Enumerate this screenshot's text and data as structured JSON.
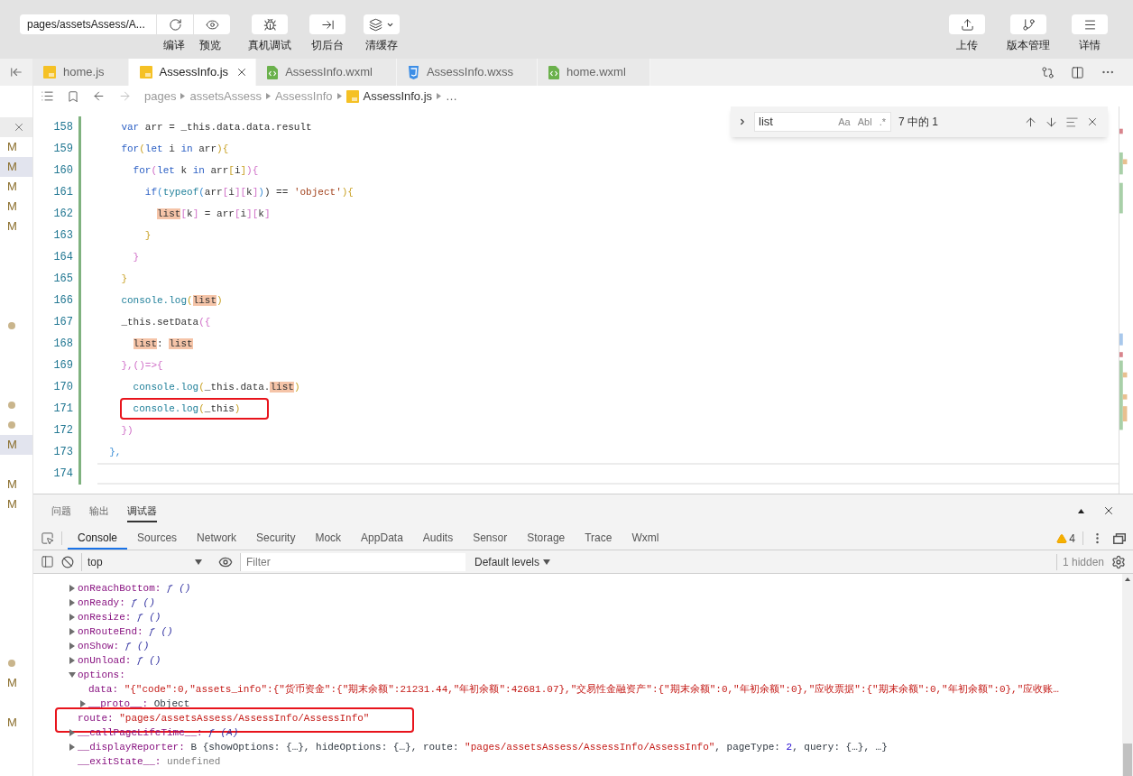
{
  "toolbar": {
    "page_select": "pages/assetsAssess/A...",
    "left_buttons": [
      {
        "kind": "compile",
        "label": "编译"
      },
      {
        "kind": "preview",
        "label": "预览"
      },
      {
        "kind": "debug",
        "label": "真机调试"
      },
      {
        "kind": "background",
        "label": "切后台"
      },
      {
        "kind": "cache",
        "label": "清缓存"
      }
    ],
    "right_buttons": [
      {
        "kind": "upload",
        "label": "上传"
      },
      {
        "kind": "version",
        "label": "版本管理"
      },
      {
        "kind": "details",
        "label": "详情"
      }
    ]
  },
  "tabs": [
    {
      "label": "home.js",
      "kind": "js",
      "selected": false
    },
    {
      "label": "AssessInfo.js",
      "kind": "js",
      "selected": true
    },
    {
      "label": "AssessInfo.wxml",
      "kind": "wxml",
      "selected": false
    },
    {
      "label": "AssessInfo.wxss",
      "kind": "wxss",
      "selected": false
    },
    {
      "label": "home.wxml",
      "kind": "wxml",
      "selected": false
    }
  ],
  "breadcrumb": [
    "pages",
    "assetsAssess",
    "AssessInfo",
    "AssessInfo.js",
    "…"
  ],
  "side_markers": [
    {
      "kind": "close"
    },
    {
      "kind": "modified",
      "label": "M",
      "selected": false
    },
    {
      "kind": "modified",
      "label": "M",
      "selected": true
    },
    {
      "kind": "modified",
      "label": "M",
      "selected": false
    },
    {
      "kind": "modified",
      "label": "M",
      "selected": false
    },
    {
      "kind": "modified",
      "label": "M",
      "selected": false
    },
    {
      "kind": "blank"
    },
    {
      "kind": "blank"
    },
    {
      "kind": "blank"
    },
    {
      "kind": "blank"
    },
    {
      "kind": "dot"
    },
    {
      "kind": "blank"
    },
    {
      "kind": "blank"
    },
    {
      "kind": "blank"
    },
    {
      "kind": "dot"
    },
    {
      "kind": "dot"
    },
    {
      "kind": "modified",
      "label": "M",
      "selected": true
    },
    {
      "kind": "blank"
    },
    {
      "kind": "modified",
      "label": "M",
      "selected": false
    },
    {
      "kind": "modified",
      "label": "M",
      "selected": false
    },
    {
      "kind": "blank"
    },
    {
      "kind": "blank"
    },
    {
      "kind": "blank"
    },
    {
      "kind": "blank"
    },
    {
      "kind": "blank"
    },
    {
      "kind": "blank"
    },
    {
      "kind": "blank"
    },
    {
      "kind": "dot"
    },
    {
      "kind": "modified",
      "label": "M",
      "selected": false
    },
    {
      "kind": "blank"
    },
    {
      "kind": "modified",
      "label": "M",
      "selected": false
    }
  ],
  "code_lines": [
    {
      "number": "158",
      "current": false,
      "boxed": false,
      "tokens": [
        {
          "text": "    var",
          "kind": "kw"
        },
        {
          "text": " arr = _this.data.data.result",
          "kind": "id"
        }
      ]
    },
    {
      "number": "159",
      "current": false,
      "boxed": false,
      "tokens": [
        {
          "text": "    for",
          "kind": "kw"
        },
        {
          "text": "(",
          "kind": "b1"
        },
        {
          "text": "let",
          "kind": "kw"
        },
        {
          "text": " i ",
          "kind": "id"
        },
        {
          "text": "in",
          "kind": "kw"
        },
        {
          "text": " arr",
          "kind": "id"
        },
        {
          "text": "){",
          "kind": "b1"
        }
      ]
    },
    {
      "number": "160",
      "current": false,
      "boxed": false,
      "tokens": [
        {
          "text": "      for",
          "kind": "kw"
        },
        {
          "text": "(",
          "kind": "b2"
        },
        {
          "text": "let",
          "kind": "kw"
        },
        {
          "text": " k ",
          "kind": "id"
        },
        {
          "text": "in",
          "kind": "kw"
        },
        {
          "text": " arr",
          "kind": "id"
        },
        {
          "text": "[",
          "kind": "b1"
        },
        {
          "text": "i",
          "kind": "id"
        },
        {
          "text": "]",
          "kind": "b1"
        },
        {
          "text": "){",
          "kind": "b2"
        }
      ]
    },
    {
      "number": "161",
      "current": false,
      "boxed": false,
      "tokens": [
        {
          "text": "        if",
          "kind": "kw"
        },
        {
          "text": "(",
          "kind": "b3"
        },
        {
          "text": "typeof",
          "kind": "fn"
        },
        {
          "text": "(",
          "kind": "b3"
        },
        {
          "text": "arr",
          "kind": "id"
        },
        {
          "text": "[",
          "kind": "b2"
        },
        {
          "text": "i",
          "kind": "id"
        },
        {
          "text": "][",
          "kind": "b2"
        },
        {
          "text": "k",
          "kind": "id"
        },
        {
          "text": "]",
          "kind": "b2"
        },
        {
          "text": ")",
          "kind": "b3"
        },
        {
          "text": ") == ",
          "kind": "id"
        },
        {
          "text": "'object'",
          "kind": "str"
        },
        {
          "text": "){",
          "kind": "b1"
        }
      ]
    },
    {
      "number": "162",
      "current": false,
      "boxed": false,
      "tokens": [
        {
          "text": "          list",
          "kind": "hl"
        },
        {
          "text": "[",
          "kind": "b2"
        },
        {
          "text": "k",
          "kind": "id"
        },
        {
          "text": "]",
          "kind": "b2"
        },
        {
          "text": " = arr",
          "kind": "id"
        },
        {
          "text": "[",
          "kind": "b2"
        },
        {
          "text": "i",
          "kind": "id"
        },
        {
          "text": "][",
          "kind": "b2"
        },
        {
          "text": "k",
          "kind": "id"
        },
        {
          "text": "]",
          "kind": "b2"
        }
      ]
    },
    {
      "number": "163",
      "current": false,
      "boxed": false,
      "tokens": [
        {
          "text": "        }",
          "kind": "b1"
        }
      ]
    },
    {
      "number": "164",
      "current": false,
      "boxed": false,
      "tokens": [
        {
          "text": "      }",
          "kind": "b2"
        }
      ]
    },
    {
      "number": "165",
      "current": false,
      "boxed": false,
      "tokens": [
        {
          "text": "    }",
          "kind": "b1"
        }
      ]
    },
    {
      "number": "166",
      "current": false,
      "boxed": false,
      "tokens": [
        {
          "text": "    console.log",
          "kind": "fn"
        },
        {
          "text": "(",
          "kind": "b1"
        },
        {
          "text": "list",
          "kind": "hl"
        },
        {
          "text": ")",
          "kind": "b1"
        }
      ]
    },
    {
      "number": "167",
      "current": false,
      "boxed": false,
      "tokens": [
        {
          "text": "    _this.setData",
          "kind": "id"
        },
        {
          "text": "({",
          "kind": "b2"
        }
      ]
    },
    {
      "number": "168",
      "current": false,
      "boxed": false,
      "tokens": [
        {
          "text": "      list",
          "kind": "hl"
        },
        {
          "text": ": ",
          "kind": "id"
        },
        {
          "text": "list",
          "kind": "hl"
        }
      ]
    },
    {
      "number": "169",
      "current": false,
      "boxed": false,
      "tokens": [
        {
          "text": "    },()=>{",
          "kind": "b2"
        }
      ]
    },
    {
      "number": "170",
      "current": false,
      "boxed": false,
      "tokens": [
        {
          "text": "      console.log",
          "kind": "fn"
        },
        {
          "text": "(",
          "kind": "b1"
        },
        {
          "text": "_this.data.",
          "kind": "id"
        },
        {
          "text": "list",
          "kind": "hl"
        },
        {
          "text": ")",
          "kind": "b1"
        }
      ]
    },
    {
      "number": "171",
      "current": false,
      "boxed": true,
      "tokens": [
        {
          "text": "      console.log",
          "kind": "fn"
        },
        {
          "text": "(",
          "kind": "b1"
        },
        {
          "text": "_this",
          "kind": "id"
        },
        {
          "text": ")",
          "kind": "b1"
        }
      ]
    },
    {
      "number": "172",
      "current": false,
      "boxed": false,
      "tokens": [
        {
          "text": "    })",
          "kind": "b2"
        }
      ]
    },
    {
      "number": "173",
      "current": false,
      "boxed": false,
      "tokens": [
        {
          "text": "  },",
          "kind": "b3"
        }
      ]
    },
    {
      "number": "174",
      "current": true,
      "boxed": false
    }
  ],
  "find": {
    "value": "list",
    "options": [
      {
        "label": "Aa",
        "selected": false
      },
      {
        "label": "Abl",
        "selected": false
      },
      {
        "label": ".*",
        "selected": false
      }
    ],
    "count": "7 中的 1"
  },
  "devtools": {
    "panels": [
      {
        "label": "问题",
        "selected": false
      },
      {
        "label": "输出",
        "selected": false
      },
      {
        "label": "调试器",
        "selected": true
      }
    ],
    "tabs": [
      {
        "label": "Console",
        "selected": true
      },
      {
        "label": "Sources",
        "selected": false
      },
      {
        "label": "Network",
        "selected": false
      },
      {
        "label": "Security",
        "selected": false
      },
      {
        "label": "Mock",
        "selected": false
      },
      {
        "label": "AppData",
        "selected": false
      },
      {
        "label": "Audits",
        "selected": false
      },
      {
        "label": "Sensor",
        "selected": false
      },
      {
        "label": "Storage",
        "selected": false
      },
      {
        "label": "Trace",
        "selected": false
      },
      {
        "label": "Wxml",
        "selected": false
      }
    ],
    "warnings": "4",
    "context": "top",
    "filter_placeholder": "Filter",
    "levels": "Default levels",
    "hidden": "1 hidden",
    "entries": [
      {
        "key": "onReachBottom:",
        "expanded": false,
        "boxed": false,
        "parts": [
          {
            "text": "ƒ ()",
            "kind": "fn"
          }
        ]
      },
      {
        "key": "onReady:",
        "expanded": false,
        "boxed": false,
        "parts": [
          {
            "text": "ƒ ()",
            "kind": "fn"
          }
        ]
      },
      {
        "key": "onResize:",
        "expanded": false,
        "boxed": false,
        "parts": [
          {
            "text": "ƒ ()",
            "kind": "fn"
          }
        ]
      },
      {
        "key": "onRouteEnd:",
        "expanded": false,
        "boxed": false,
        "parts": [
          {
            "text": "ƒ ()",
            "kind": "fn"
          }
        ]
      },
      {
        "key": "onShow:",
        "expanded": false,
        "boxed": false,
        "parts": [
          {
            "text": "ƒ ()",
            "kind": "fn"
          }
        ]
      },
      {
        "key": "onUnload:",
        "expanded": false,
        "boxed": false,
        "parts": [
          {
            "text": "ƒ ()",
            "kind": "fn"
          }
        ]
      },
      {
        "key": "options:",
        "expanded": true,
        "boxed": false,
        "children": [
          {
            "key": "data:",
            "boxed": false,
            "parts": [
              {
                "text": "\"{\"code\":0,\"assets_info\":{\"货币资金\":{\"期末余额\":21231.44,\"年初余额\":42681.07},\"交易性金融资产\":{\"期末余额\":0,\"年初余额\":0},\"应收票据\":{\"期末余额\":0,\"年初余额\":0},\"应收账…",
                "kind": "string"
              }
            ]
          },
          {
            "key": "__proto__:",
            "expanded": false,
            "boxed": false,
            "parts": [
              {
                "text": "Object",
                "kind": "plain"
              }
            ]
          }
        ]
      },
      {
        "key": "route:",
        "boxed": true,
        "parts": [
          {
            "text": "\"pages/assetsAssess/AssessInfo/AssessInfo\"",
            "kind": "string"
          }
        ]
      },
      {
        "key": "__callPageLifeTime__:",
        "expanded": false,
        "boxed": false,
        "parts": [
          {
            "text": "ƒ (A)",
            "kind": "fn"
          }
        ]
      },
      {
        "key": "__displayReporter:",
        "expanded": false,
        "boxed": false,
        "parts": [
          {
            "text": "B {showOptions: {…}, hideOptions: {…}, route: ",
            "kind": "plain"
          },
          {
            "text": "\"pages/assetsAssess/AssessInfo/AssessInfo\"",
            "kind": "string"
          },
          {
            "text": ", pageType: ",
            "kind": "plain"
          },
          {
            "text": "2",
            "kind": "number"
          },
          {
            "text": ", query: {…}, …}",
            "kind": "plain"
          }
        ]
      },
      {
        "key": "__exitState__:",
        "boxed": false,
        "parts": [
          {
            "text": "undefined",
            "kind": "undefined"
          }
        ]
      }
    ]
  }
}
